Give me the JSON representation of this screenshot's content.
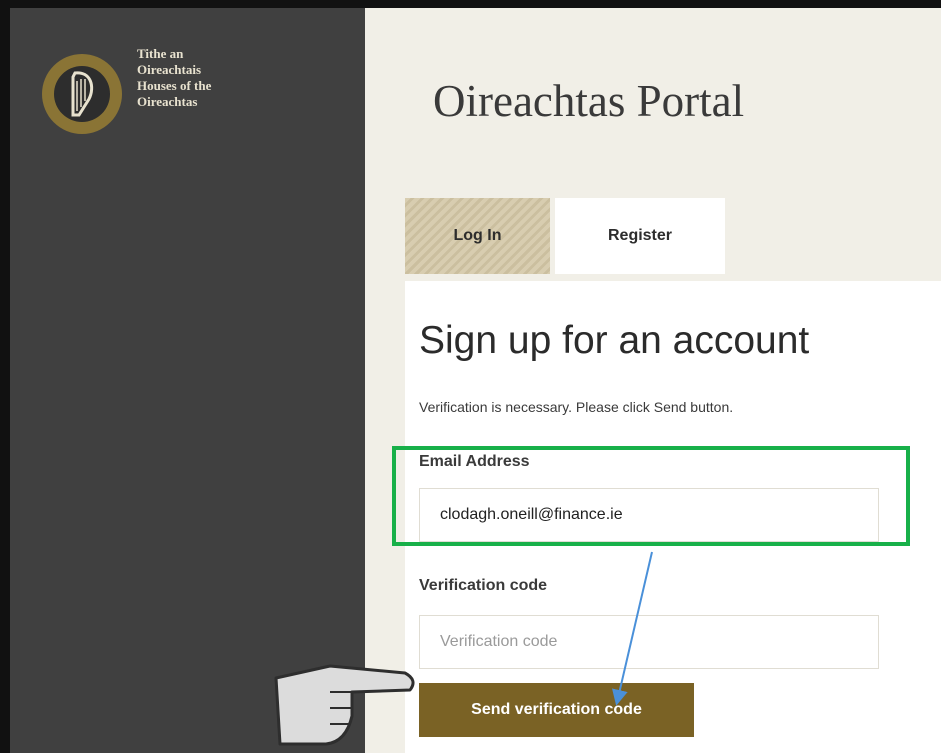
{
  "logo": {
    "lines": [
      "Tithe an",
      "Oireachtais",
      "Houses of the",
      "Oireachtas"
    ]
  },
  "portal_title": "Oireachtas Portal",
  "tabs": [
    {
      "label": "Log In"
    },
    {
      "label": "Register"
    }
  ],
  "form": {
    "heading": "Sign up for an account",
    "note": "Verification is necessary. Please click Send button.",
    "email_label": "Email Address",
    "email_value": "clodagh.oneill@finance.ie",
    "code_label": "Verification code",
    "code_placeholder": "Verification code",
    "send_label": "Send verification code"
  },
  "colors": {
    "accent": "#7a6225",
    "highlight": "#18b049",
    "arrow": "#4a90d9",
    "sidebar": "#404040"
  },
  "icons": {
    "crest": "harp-icon",
    "pointer": "pointing-hand-icon"
  }
}
